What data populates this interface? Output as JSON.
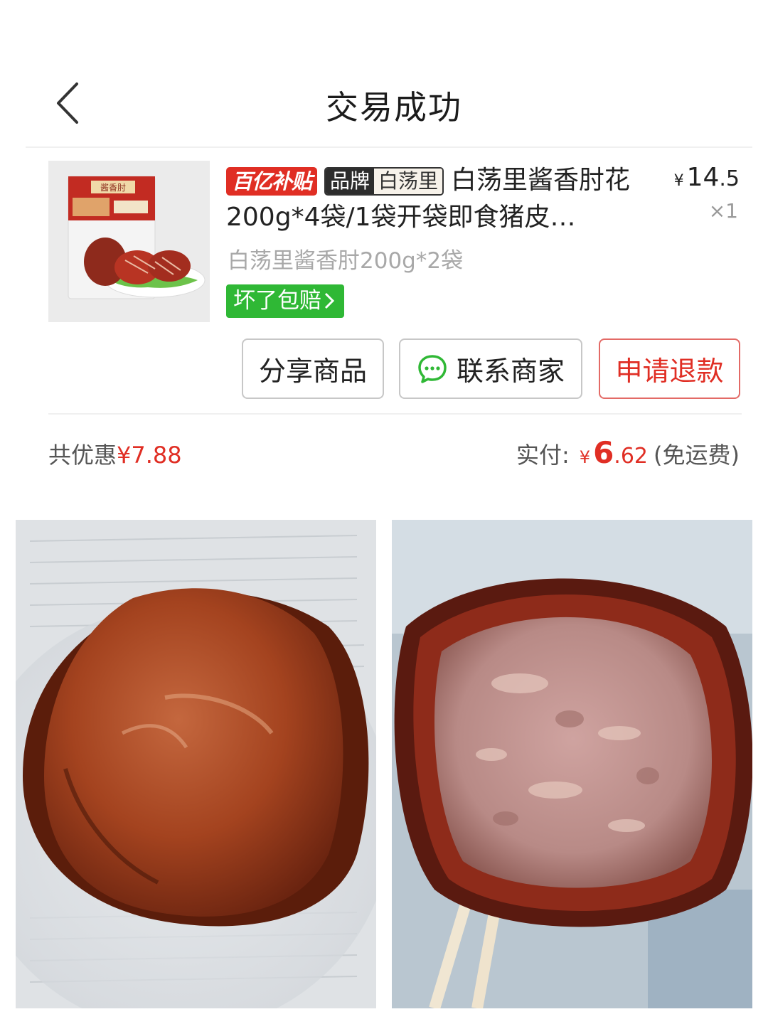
{
  "header": {
    "title": "交易成功"
  },
  "product": {
    "badge_subsidy": "百亿补贴",
    "brand_key": "品牌",
    "brand_value": "白荡里",
    "title": "白荡里酱香肘花200g*4袋/1袋开袋即食猪皮…",
    "thumb_label": "酱香肘",
    "price_currency": "¥",
    "price_int": "14",
    "price_dec": ".5",
    "quantity": "×1",
    "spec": "白荡里酱香肘200g*2袋",
    "guarantee": "坏了包赔"
  },
  "actions": {
    "share": "分享商品",
    "contact": "联系商家",
    "refund": "申请退款"
  },
  "summary": {
    "discount_label": "共优惠",
    "discount_amount": "¥7.88",
    "paid_label": "实付:",
    "paid_currency": "¥",
    "paid_int": "6",
    "paid_dec": ".62",
    "shipping_note": "(免运费)"
  },
  "colors": {
    "accent_red": "#e02e24",
    "guarantee_green": "#2fb835"
  }
}
